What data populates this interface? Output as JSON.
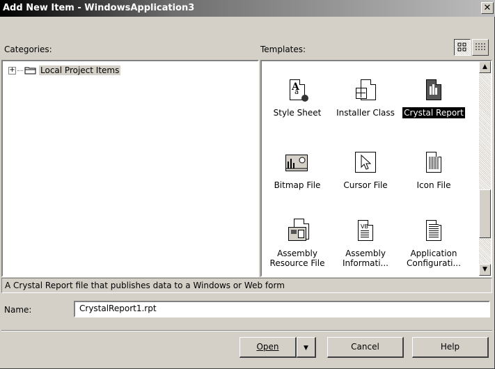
{
  "window": {
    "title": "Add New Item - WindowsApplication3",
    "close_glyph": "✕"
  },
  "categories": {
    "label": "Categories:",
    "tree": [
      {
        "expander": "+",
        "label": "Local Project Items",
        "icon": "folder-icon"
      }
    ]
  },
  "templates": {
    "label": "Templates:",
    "view_buttons": [
      {
        "name": "large-icons-view",
        "icon": "large-icons-icon"
      },
      {
        "name": "list-view",
        "icon": "list-icon"
      }
    ],
    "items": [
      {
        "label": "Style Sheet",
        "icon": "style-sheet-icon"
      },
      {
        "label": "Installer Class",
        "icon": "installer-class-icon"
      },
      {
        "label": "Crystal Report",
        "icon": "crystal-report-icon",
        "selected": true
      },
      {
        "label": "Bitmap File",
        "icon": "bitmap-icon"
      },
      {
        "label": "Cursor File",
        "icon": "cursor-icon"
      },
      {
        "label": "Icon File",
        "icon": "icon-file-icon"
      },
      {
        "label": "Assembly",
        "label2": "Resource File",
        "icon": "assembly-resource-icon"
      },
      {
        "label": "Assembly",
        "label2": "Informati...",
        "icon": "assembly-info-icon"
      },
      {
        "label": "Application",
        "label2": "Configurati...",
        "icon": "app-config-icon"
      }
    ]
  },
  "description": "A Crystal Report file that publishes data to a Windows or Web form",
  "name_field": {
    "label": "Name:",
    "value": "CrystalReport1.rpt"
  },
  "buttons": {
    "open": "Open",
    "open_arrow": "▼",
    "cancel": "Cancel",
    "help": "Help"
  },
  "scrollbar": {
    "up": "▲",
    "down": "▼"
  }
}
